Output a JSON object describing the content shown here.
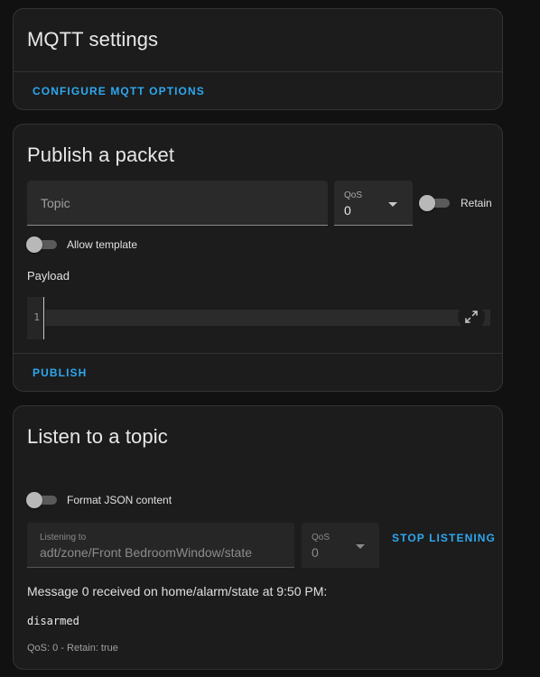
{
  "mqtt_settings": {
    "title": "MQTT settings",
    "configure_button": "CONFIGURE MQTT OPTIONS"
  },
  "publish": {
    "title": "Publish a packet",
    "topic_placeholder": "Topic",
    "qos_label": "QoS",
    "qos_value": "0",
    "retain_label": "Retain",
    "retain_on": false,
    "allow_template_label": "Allow template",
    "allow_template_on": false,
    "payload_label": "Payload",
    "line_number": "1",
    "publish_button": "PUBLISH"
  },
  "listen": {
    "title": "Listen to a topic",
    "format_json_label": "Format JSON content",
    "format_json_on": false,
    "listening_label": "Listening to",
    "listening_value": "adt/zone/Front BedroomWindow/state",
    "qos_label": "QoS",
    "qos_value": "0",
    "stop_button": "STOP LISTENING",
    "message_header": "Message 0 received on home/alarm/state at 9:50 PM:",
    "message_payload": "disarmed",
    "message_meta": "QoS: 0 - Retain: true"
  },
  "colors": {
    "background": "#111111",
    "card": "#1c1c1c",
    "accent": "#2ea8f0"
  },
  "icons": {
    "expand": "expand-arrows-icon",
    "dropdown": "caret-down-icon"
  }
}
